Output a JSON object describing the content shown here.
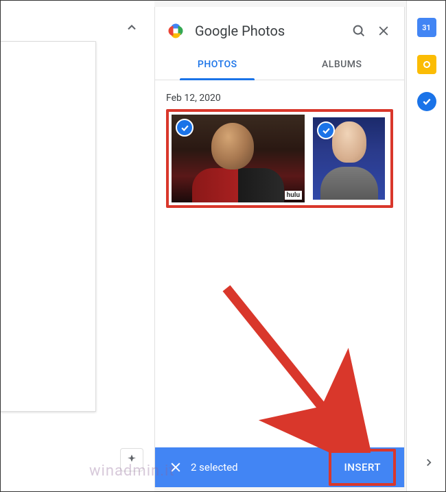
{
  "panel": {
    "title": "Google Photos",
    "tabs": [
      {
        "label": "PHOTOS",
        "active": true
      },
      {
        "label": "ALBUMS",
        "active": false
      }
    ]
  },
  "photos": {
    "date_group": "Feb 12, 2020",
    "items": [
      {
        "selected": true,
        "badge_text": "hulu"
      },
      {
        "selected": true
      }
    ]
  },
  "selection_bar": {
    "count_text": "2 selected",
    "action_label": "INSERT"
  },
  "rail": {
    "calendar_day": "31"
  },
  "watermark": "winadmin.it"
}
